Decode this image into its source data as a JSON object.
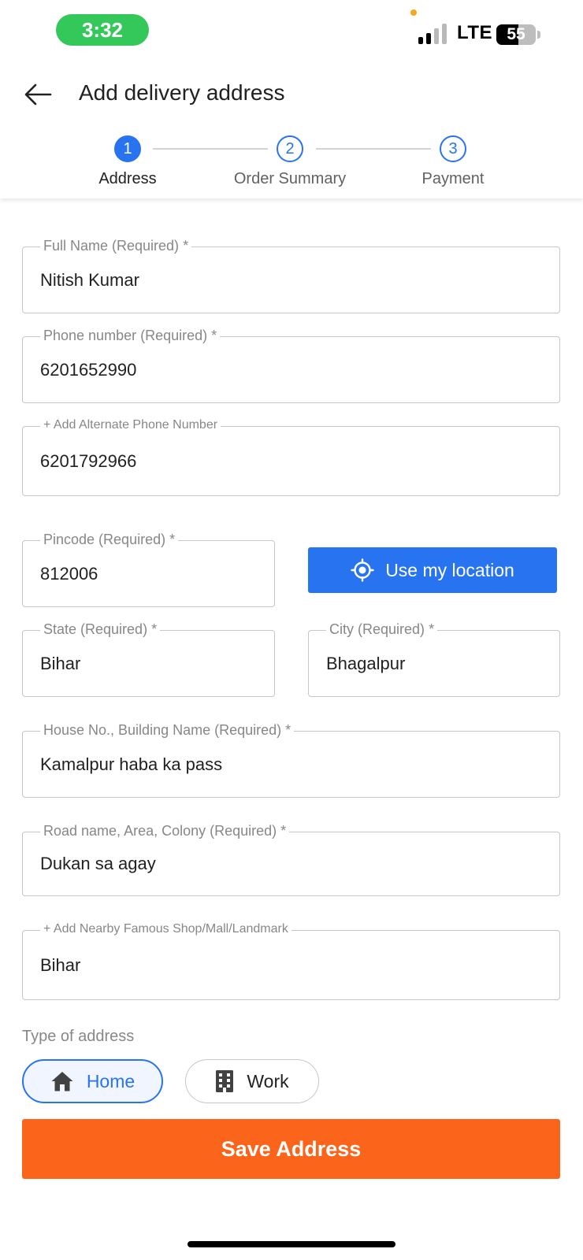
{
  "status_bar": {
    "time": "3:32",
    "network": "LTE",
    "battery": "55"
  },
  "header": {
    "title": "Add delivery address",
    "steps": [
      {
        "number": "1",
        "label": "Address",
        "active": true
      },
      {
        "number": "2",
        "label": "Order Summary",
        "active": false
      },
      {
        "number": "3",
        "label": "Payment",
        "active": false
      }
    ]
  },
  "form": {
    "full_name": {
      "label": "Full Name (Required)",
      "value": "Nitish Kumar"
    },
    "phone": {
      "label": "Phone number (Required)",
      "value": "6201652990"
    },
    "alternate_phone": {
      "label": "+ Add Alternate Phone Number",
      "value": "6201792966"
    },
    "pincode": {
      "label": "Pincode (Required)",
      "value": "812006"
    },
    "use_location": {
      "label": "Use my location"
    },
    "state": {
      "label": "State (Required)",
      "value": "Bihar"
    },
    "city": {
      "label": "City (Required)",
      "value": "Bhagalpur"
    },
    "house": {
      "label": "House No., Building Name (Required)",
      "value": "Kamalpur haba ka pass"
    },
    "road": {
      "label": "Road name, Area, Colony (Required)",
      "value": "Dukan sa agay"
    },
    "landmark": {
      "label": "+ Add Nearby Famous Shop/Mall/Landmark",
      "value": "Bihar"
    },
    "required_mark": "*"
  },
  "address_type": {
    "label": "Type of address",
    "options": [
      {
        "label": "Home",
        "icon": "home-icon",
        "selected": true
      },
      {
        "label": "Work",
        "icon": "building-icon",
        "selected": false
      }
    ]
  },
  "save_button": {
    "label": "Save Address"
  },
  "colors": {
    "primary": "#2874f0",
    "save": "#fb641b",
    "status_time": "#34c759"
  }
}
